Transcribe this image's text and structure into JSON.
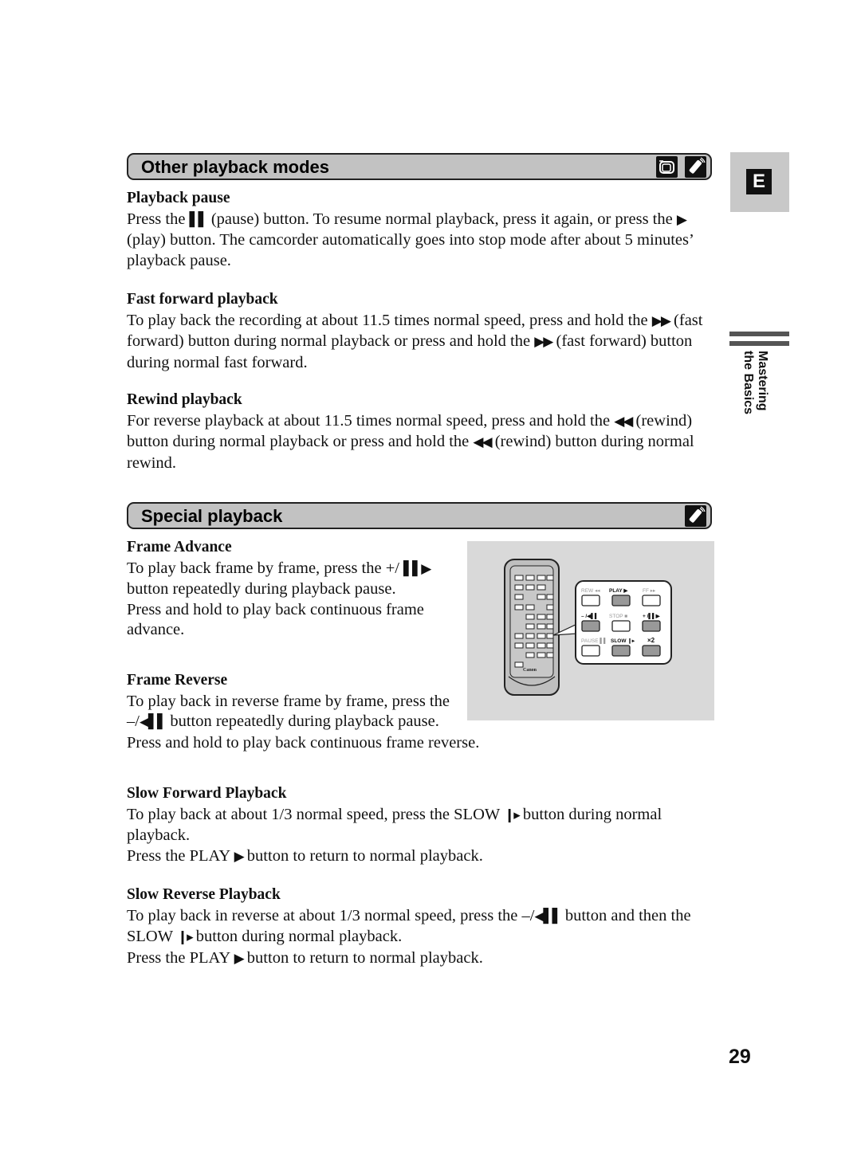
{
  "sections": {
    "other": {
      "title": "Other playback modes",
      "icons": [
        "camcorder-icon",
        "remote-control-icon"
      ],
      "playback_pause": {
        "heading": "Playback pause",
        "p1_a": "Press the ",
        "p1_glyph": "▌▌",
        "p1_b": " (pause) button. To resume normal playback, press it again, or press the ",
        "p1_glyph2": "▶",
        "p1_c": " (play) button. The camcorder automatically goes into stop mode after about 5 minutes’ playback pause."
      },
      "fast_forward": {
        "heading": "Fast forward playback",
        "a": "To play back the recording at about 11.5 times normal speed, press and hold the ",
        "glyph": "▶▶",
        "b": " (fast forward) button during normal playback or press and hold the ",
        "c": " (fast forward) button during normal fast forward."
      },
      "rewind": {
        "heading": "Rewind playback",
        "a": "For reverse playback at about 11.5 times normal speed, press and hold the ",
        "glyph": "◀◀",
        "b": " (rewind) button during normal playback or press and hold the ",
        "c": " (rewind) button during normal rewind."
      }
    },
    "special": {
      "title": "Special playback",
      "icons": [
        "remote-control-icon"
      ],
      "frame_advance": {
        "heading": "Frame Advance",
        "a": "To play back frame by frame, press the +/ ",
        "glyph": "▌▌▶",
        "b": " button repeatedly during playback pause.",
        "c": "Press and hold to play back continuous frame advance."
      },
      "frame_reverse": {
        "heading": "Frame Reverse",
        "a": "To play back in reverse frame by frame, press the –/",
        "glyph": "◀▌▌",
        "b": " button repeatedly during playback pause.",
        "c": "Press and hold to play back continuous frame reverse."
      },
      "slow_forward": {
        "heading": "Slow Forward Playback",
        "a": "To play back at about 1/3 normal speed, press the SLOW ",
        "glyph": "❙▸",
        "b": " button during normal playback.",
        "c1": "Press the PLAY ",
        "c_glyph": "▶",
        "c2": " button to return to normal playback."
      },
      "slow_reverse": {
        "heading": "Slow Reverse Playback",
        "a": "To play back in reverse at about 1/3 normal speed, press the –/",
        "glyph": "◀▌▌",
        "b": " button and then the SLOW ",
        "glyph2": "❙▸",
        "c": " button during normal playback.",
        "d1": "Press the PLAY ",
        "d_glyph": "▶",
        "d2": " button to return to normal playback."
      }
    }
  },
  "figure": {
    "brand": "Canon",
    "callout_labels": {
      "rew": "REW ◂◂",
      "play": "PLAY ▶",
      "ff": "FF ▸▸",
      "minus": "– /◀▌▌",
      "stop": "STOP ■",
      "plus": "+ /▌▌▶",
      "pause": "PAUSE ▌▌",
      "slow": "SLOW ❙▸",
      "x2": "×2"
    }
  },
  "sidebar": {
    "language_tab": "E",
    "chapter_line1": "Mastering",
    "chapter_line2": "the Basics"
  },
  "page_number": "29"
}
